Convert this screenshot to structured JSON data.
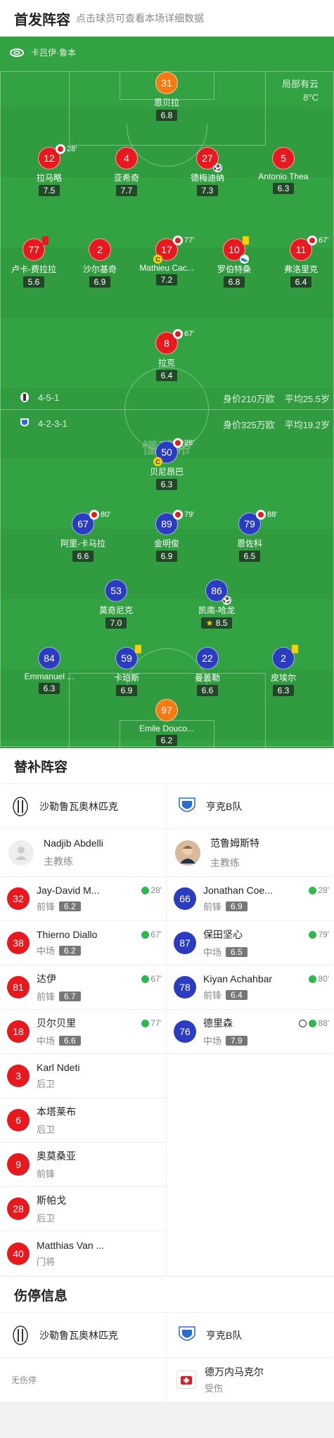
{
  "header": {
    "title": "首发阵容",
    "subtitle": "点击球员可查看本场详细数据"
  },
  "pitch": {
    "venue": "卡吕伊·鲁本",
    "weather": {
      "condition": "局部有云",
      "temp": "8°C"
    },
    "home": {
      "formation": "4-5-1",
      "value": "身价210万欧",
      "avg_age": "平均25.5岁"
    },
    "away": {
      "formation": "4-2-3-1",
      "value": "身价325万欧",
      "avg_age": "平均19.2岁"
    },
    "watermark": "懂球帝",
    "home_players": [
      {
        "num": "31",
        "name": "恩贝拉",
        "rating": "6.8",
        "kind": "gk"
      },
      {
        "num": "12",
        "name": "拉马略",
        "rating": "7.5",
        "sub": "28'"
      },
      {
        "num": "4",
        "name": "亚希奇",
        "rating": "7.7"
      },
      {
        "num": "27",
        "name": "德梅迪纳",
        "rating": "7.3",
        "goal": true
      },
      {
        "num": "5",
        "name": "Antonio Thea",
        "rating": "6.3"
      },
      {
        "num": "77",
        "name": "卢卡-费拉拉",
        "rating": "5.6",
        "red": true
      },
      {
        "num": "2",
        "name": "沙尔基奇",
        "rating": "6.9"
      },
      {
        "num": "17",
        "name": "Mathieu Cac...",
        "rating": "7.2",
        "sub": "77'",
        "captain": true
      },
      {
        "num": "10",
        "name": "罗伯特桑",
        "rating": "6.8",
        "yellow": true,
        "assist": true
      },
      {
        "num": "11",
        "name": "弗洛里克",
        "rating": "6.4",
        "sub": "67'"
      },
      {
        "num": "8",
        "name": "拉克",
        "rating": "6.4",
        "sub": "67'"
      }
    ],
    "away_players": [
      {
        "num": "50",
        "name": "贝尼昂巴",
        "rating": "6.3",
        "sub": "28'",
        "captain": true
      },
      {
        "num": "67",
        "name": "阿里-卡马拉",
        "rating": "6.6",
        "sub": "80'"
      },
      {
        "num": "89",
        "name": "金明俊",
        "rating": "6.9",
        "sub": "79'"
      },
      {
        "num": "79",
        "name": "恩佐科",
        "rating": "6.5",
        "sub": "88'"
      },
      {
        "num": "53",
        "name": "莫奇尼克",
        "rating": "7.0"
      },
      {
        "num": "86",
        "name": "凯南-哈龙",
        "rating": "8.5",
        "goal": true,
        "star": true
      },
      {
        "num": "84",
        "name": "Emmanuel ...",
        "rating": "6.3"
      },
      {
        "num": "59",
        "name": "卡珀斯",
        "rating": "6.9",
        "yellow": true
      },
      {
        "num": "22",
        "name": "曼盖勒",
        "rating": "6.6"
      },
      {
        "num": "2",
        "name": "皮埃尔",
        "rating": "6.3",
        "yellow": true
      },
      {
        "num": "97",
        "name": "Emile Douco...",
        "rating": "6.2",
        "kind": "gk"
      }
    ]
  },
  "subs": {
    "title": "替补阵容",
    "home": {
      "team": "沙勒鲁瓦奥林匹克",
      "coach": {
        "name": "Nadjib Abdelli",
        "role": "主教练"
      },
      "players": [
        {
          "num": "32",
          "name": "Jay-David M...",
          "pos": "前锋",
          "rating": "6.2",
          "time": "28'"
        },
        {
          "num": "38",
          "name": "Thierno Diallo",
          "pos": "中场",
          "rating": "6.2",
          "time": "67'"
        },
        {
          "num": "81",
          "name": "达伊",
          "pos": "前锋",
          "rating": "6.7",
          "time": "67'"
        },
        {
          "num": "18",
          "name": "贝尔贝里",
          "pos": "中场",
          "rating": "6.6",
          "time": "77'"
        },
        {
          "num": "3",
          "name": "Karl Ndeti",
          "pos": "后卫"
        },
        {
          "num": "6",
          "name": "本塔莱布",
          "pos": "后卫"
        },
        {
          "num": "9",
          "name": "奥莫桑亚",
          "pos": "前锋"
        },
        {
          "num": "28",
          "name": "斯帕戈",
          "pos": "后卫"
        },
        {
          "num": "40",
          "name": "Matthias Van ...",
          "pos": "门将"
        }
      ]
    },
    "away": {
      "team": "亨克B队",
      "coach": {
        "name": "范鲁姆斯特",
        "role": "主教练"
      },
      "players": [
        {
          "num": "66",
          "name": "Jonathan Coe...",
          "pos": "前锋",
          "rating": "6.9",
          "time": "28'"
        },
        {
          "num": "87",
          "name": "保田坚心",
          "pos": "中场",
          "rating": "6.5",
          "time": "79'"
        },
        {
          "num": "78",
          "name": "Kiyan Achahbar",
          "pos": "前锋",
          "rating": "6.4",
          "time": "80'"
        },
        {
          "num": "76",
          "name": "德里森",
          "pos": "中场",
          "rating": "7.9",
          "time": "88'",
          "goal": true
        }
      ]
    }
  },
  "injuries": {
    "title": "伤停信息",
    "home": {
      "team": "沙勒鲁瓦奥林匹克",
      "none": "无伤停"
    },
    "away": {
      "team": "亨克B队",
      "player": "德万内马克尔",
      "status": "受伤"
    }
  },
  "colors": {
    "pitch": "#32a242",
    "home": "#e8191e",
    "away": "#2a3cc1",
    "keeper": "#f57a12",
    "card": "#f7d000"
  }
}
